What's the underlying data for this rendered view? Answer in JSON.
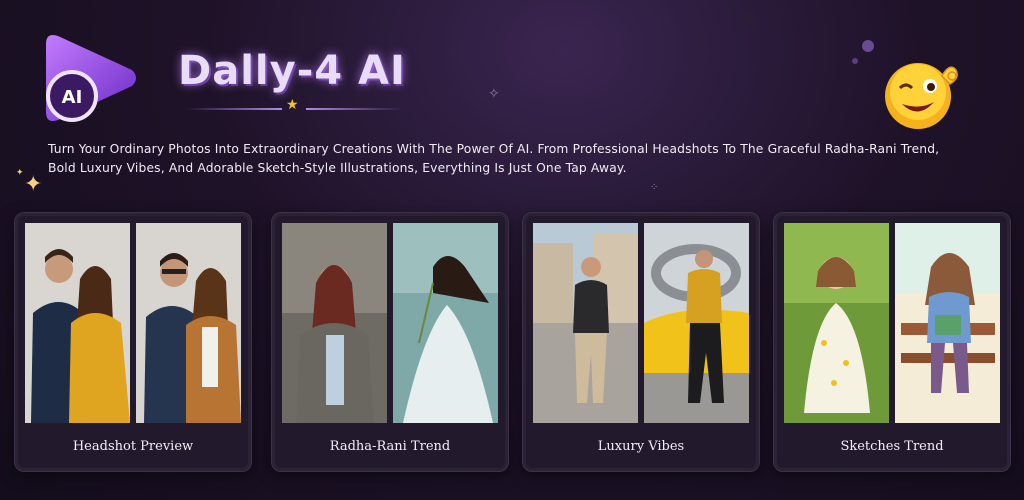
{
  "header": {
    "logo_badge": "AI",
    "title": "Dally-4 AI",
    "tagline": "Turn Your Ordinary Photos Into Extraordinary Creations With The Power Of AI. From Professional Headshots To The Graceful Radha-Rani Trend, Bold Luxury Vibes, And Adorable Sketch-Style Illustrations, Everything Is Just One Tap Away."
  },
  "colors": {
    "accent": "#8b4fd8",
    "background": "#1e1228",
    "card": "#221a2c"
  },
  "cards": [
    {
      "caption": "Headshot Preview",
      "icons": [
        "couple-photo",
        "couple-photo"
      ]
    },
    {
      "caption": "Radha-Rani Trend",
      "icons": [
        "woman-portrait",
        "woman-in-gown"
      ]
    },
    {
      "caption": "Luxury Vibes",
      "icons": [
        "man-in-city",
        "man-with-sports-car"
      ]
    },
    {
      "caption": "Sketches Trend",
      "icons": [
        "child-in-park",
        "girl-sketch"
      ]
    }
  ]
}
